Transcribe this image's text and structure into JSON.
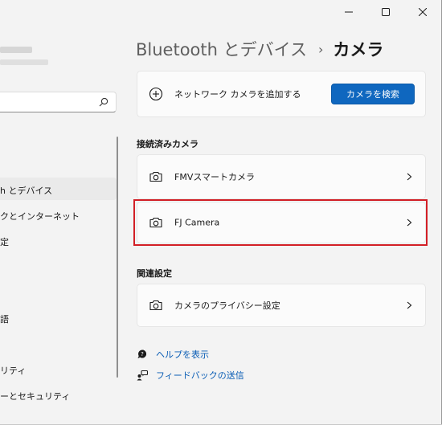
{
  "window": {
    "caption": {
      "minimize": "minimize-icon",
      "maximize": "maximize-icon",
      "close": "close-icon"
    }
  },
  "sidebar": {
    "search_icon": "search-icon",
    "items": [
      {
        "label": "h とデバイス",
        "selected": true
      },
      {
        "label": "クとインターネット"
      },
      {
        "label": "定"
      },
      {
        "label": "語"
      },
      {
        "label": "リティ"
      },
      {
        "label": "ーとセキュリティ"
      }
    ]
  },
  "header": {
    "parent": "Bluetooth とデバイス",
    "separator": "›",
    "current": "カメラ"
  },
  "add_camera": {
    "label": "ネットワーク カメラを追加する",
    "button": "カメラを検索"
  },
  "connected": {
    "title": "接続済みカメラ",
    "cameras": [
      {
        "label": "FMVスマートカメラ",
        "icon": "camera-icon"
      },
      {
        "label": "FJ Camera",
        "icon": "camera-icon",
        "highlighted": true
      }
    ]
  },
  "related": {
    "title": "関連設定",
    "items": [
      {
        "label": "カメラのプライバシー設定",
        "icon": "camera-icon"
      }
    ]
  },
  "links": {
    "help": "ヘルプを表示",
    "feedback": "フィードバックの送信"
  },
  "colors": {
    "accent": "#0f67bf",
    "highlight": "#d21f26",
    "link": "#0a5db5"
  }
}
